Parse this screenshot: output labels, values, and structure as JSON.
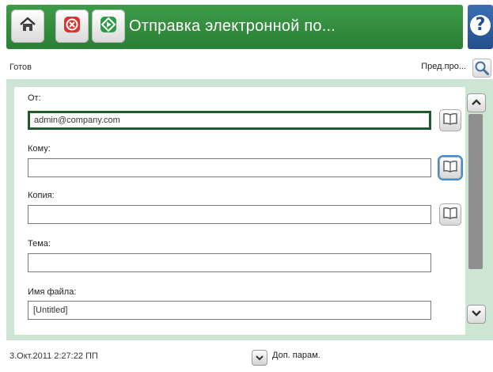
{
  "header": {
    "title": "Отправка электронной по...",
    "home_icon": "home-icon",
    "stop_icon": "stop-icon",
    "start_icon": "start-icon",
    "help_icon": "help-icon",
    "help_glyph": "?"
  },
  "status": {
    "text": "Готов",
    "preview_label": "Пред.про...",
    "preview_icon": "magnifier-icon"
  },
  "form": {
    "from_label": "От:",
    "from_value": "admin@company.com",
    "to_label": "Кому:",
    "to_value": "",
    "cc_label": "Копия:",
    "cc_value": "",
    "subject_label": "Тема:",
    "subject_value": "",
    "filename_label": "Имя файла:",
    "filename_value": "[Untitled]",
    "address_book_icon": "address-book-icon"
  },
  "footer": {
    "datetime": "3.Окт.2011 2:27:22 ПП",
    "more_options_label": "Доп. парам."
  },
  "colors": {
    "header_green": "#2f8a3b",
    "help_blue": "#2b5c9e",
    "panel_bg": "#cce6d3",
    "active_field_border": "#1e5a2a",
    "selected_outline": "#3c8ed6",
    "stop_red": "#d9342b",
    "start_green": "#2f9a47"
  }
}
